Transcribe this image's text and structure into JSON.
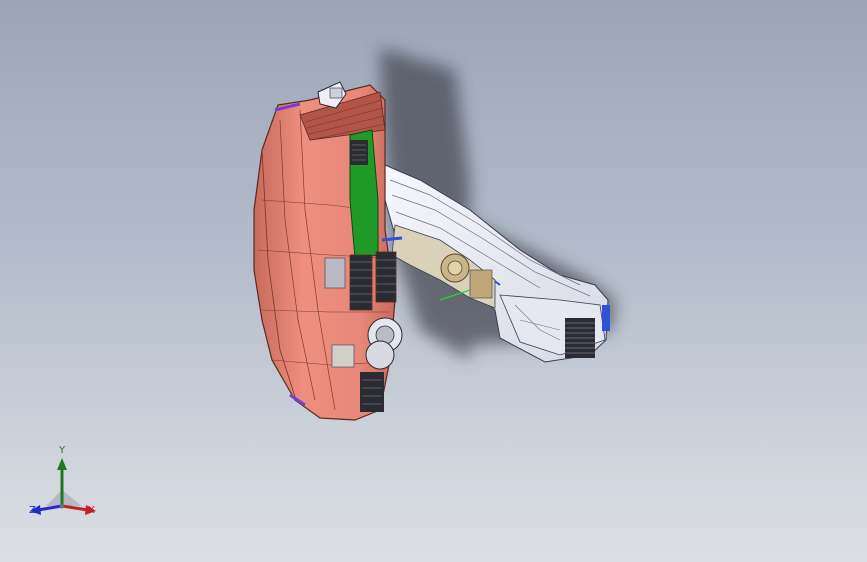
{
  "triad": {
    "y_label": "Y",
    "x_label": "X",
    "z_label": "Z"
  },
  "colors": {
    "background_top": "#9aa6b8",
    "background_bottom": "#dcdfe4",
    "shell": "#e88878",
    "shell_dark": "#b65c4e",
    "duct_green": "#1f9a26",
    "body_white": "#eef0f6",
    "accent_purple": "#7a3bd1",
    "accent_blue": "#2f52d6",
    "shadow": "#4a4c55",
    "axis_x": "#c81e1e",
    "axis_y": "#1f7a1f",
    "axis_z": "#1e2cc8"
  }
}
